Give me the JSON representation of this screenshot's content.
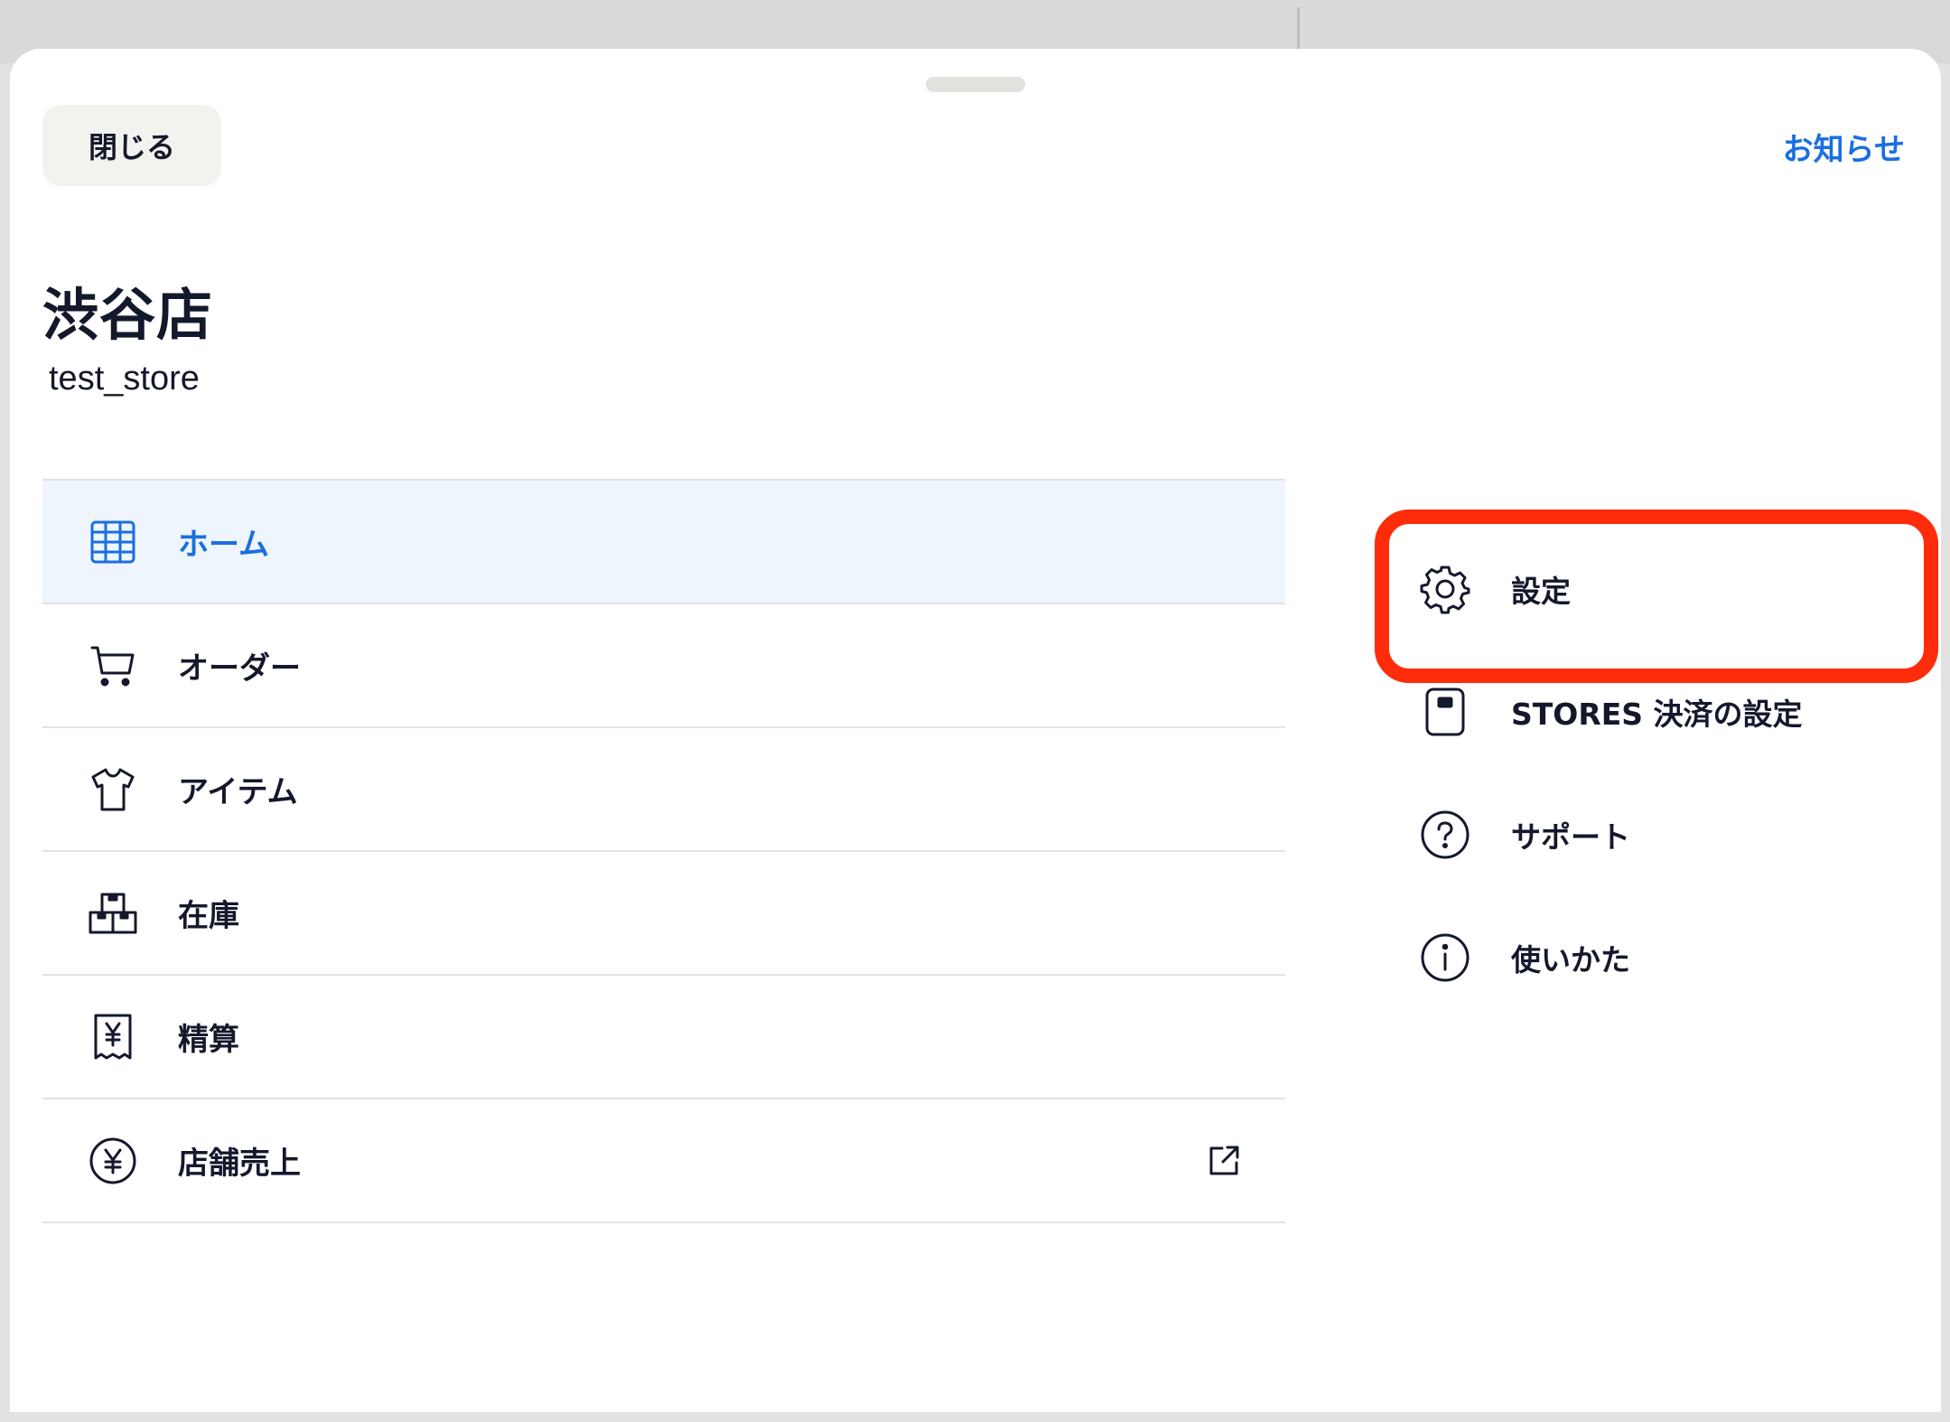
{
  "sheet": {
    "close_label": "閉じる",
    "notice_label": "お知らせ"
  },
  "store": {
    "name": "渋谷店",
    "id": "test_store"
  },
  "nav": {
    "items": [
      {
        "label": "ホーム",
        "icon": "grid-icon",
        "active": true
      },
      {
        "label": "オーダー",
        "icon": "cart-icon"
      },
      {
        "label": "アイテム",
        "icon": "shirt-icon"
      },
      {
        "label": "在庫",
        "icon": "boxes-icon"
      },
      {
        "label": "精算",
        "icon": "receipt-yen-icon"
      },
      {
        "label": "店舗売上",
        "icon": "yen-circle-icon",
        "external": true
      }
    ]
  },
  "side": {
    "items": [
      {
        "label": "設定",
        "icon": "gear-icon",
        "highlighted": true
      },
      {
        "label": "STORES 決済の設定",
        "icon": "card-reader-icon"
      },
      {
        "label": "サポート",
        "icon": "question-circle-icon"
      },
      {
        "label": "使いかた",
        "icon": "info-circle-icon"
      }
    ]
  },
  "colors": {
    "accent": "#1a6fe0",
    "active_row": "#eef5fd",
    "text": "#14182b",
    "highlight": "#fe2c0a"
  }
}
